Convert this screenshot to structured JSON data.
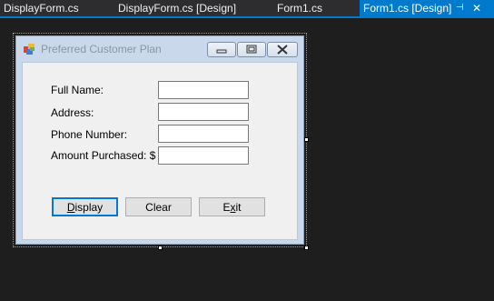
{
  "tabs": [
    {
      "label": "DisplayForm.cs",
      "active": false
    },
    {
      "label": "DisplayForm.cs [Design]",
      "active": false
    },
    {
      "label": "Form1.cs",
      "active": false
    },
    {
      "label": "Form1.cs [Design]",
      "active": true
    }
  ],
  "tab_pin_glyph": "⊣",
  "tab_close_glyph": "✕",
  "form": {
    "title": "Preferred Customer Plan",
    "icon": "windows-form-icon",
    "labels": {
      "full_name": "Full Name:",
      "address": "Address:",
      "phone": "Phone Number:",
      "amount": "Amount Purchased: $"
    },
    "fields": {
      "full_name": "",
      "address": "",
      "phone": "",
      "amount": ""
    },
    "buttons": {
      "display_prefix": "",
      "display_mnemonic": "D",
      "display_rest": "isplay",
      "clear": "Clear",
      "exit_prefix": "E",
      "exit_mnemonic": "x",
      "exit_rest": "it"
    }
  },
  "colors": {
    "ide_background": "#1e1e1e",
    "tab_active": "#007acc",
    "form_frame": "#c9d8ea",
    "client_area": "#f0f0f0"
  }
}
